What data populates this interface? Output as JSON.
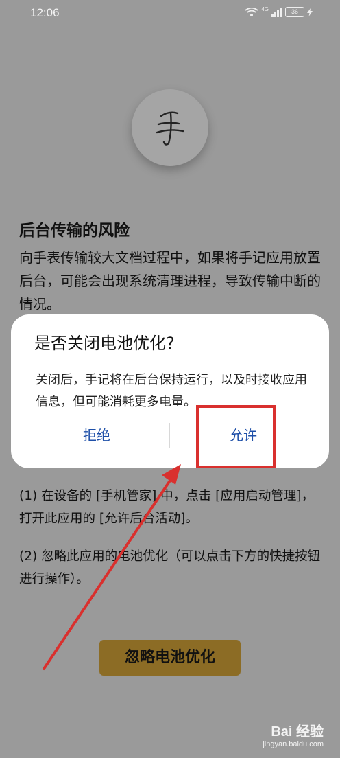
{
  "status_bar": {
    "time": "12:06",
    "network_label": "4G",
    "battery_level": "36"
  },
  "content": {
    "title": "后台传输的风险",
    "paragraph": "向手表传输较大文档过程中，如果将手记应用放置后台，可能会出现系统清理进程，导致传输中断的情况。",
    "step1": "(1) 在设备的 [手机管家] 中，点击 [应用启动管理]，打开此应用的 [允许后台活动]。",
    "step2": "(2) 忽略此应用的电池优化（可以点击下方的快捷按钮进行操作）。",
    "primary_button": "忽略电池优化"
  },
  "dialog": {
    "title": "是否关闭电池优化?",
    "message": "关闭后，手记将在后台保持运行，以及时接收应用信息，但可能消耗更多电量。",
    "deny_label": "拒绝",
    "allow_label": "允许"
  },
  "watermark": {
    "main": "Bai 经验",
    "sub": "jingyan.baidu.com"
  },
  "colors": {
    "highlight": "#d9302e",
    "dialog_button": "#1e4fa8",
    "primary_button": "#8c6c25"
  }
}
